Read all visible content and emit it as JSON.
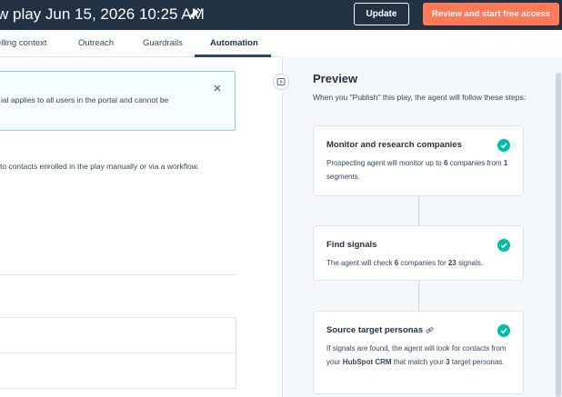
{
  "header": {
    "title": "w play Jun 15, 2026 10:25 AM",
    "update_label": "Update",
    "review_label": "Review and start free access"
  },
  "tabs": [
    {
      "label": "elling context",
      "active": false
    },
    {
      "label": "Outreach",
      "active": false
    },
    {
      "label": "Guardrails",
      "active": false
    },
    {
      "label": "Automation",
      "active": true
    }
  ],
  "main": {
    "notice_text": "ial applies to all users in the portal and cannot be",
    "body_text": "to contacts enrolled in the play manually or via a workflow."
  },
  "preview": {
    "title": "Preview",
    "description": "When you \"Publish\" this play, the agent will follow these steps:",
    "steps": [
      {
        "title": "Monitor and research companies",
        "text_parts": [
          "Prospecting agent will monitor up to ",
          "6",
          " companies from ",
          "1",
          " segments."
        ]
      },
      {
        "title": "Find signals",
        "text_parts": [
          "The agent will check ",
          "6",
          " companies for ",
          "23",
          " signals."
        ]
      },
      {
        "title": "Source target personas",
        "text_parts": [
          "If signals are found, the agent will look for contacts from your ",
          "HubSpot CRM",
          " that match your ",
          "3",
          " target personas."
        ]
      }
    ]
  },
  "colors": {
    "header_bg": "#213343",
    "accent": "#ff7a59",
    "check": "#00bda5",
    "notice_border": "#7fd1de"
  },
  "icons": {
    "edit": "pencil-icon",
    "close": "close-icon",
    "collapse": "collapse-panel-icon",
    "complete": "check-icon",
    "link": "link-icon"
  }
}
